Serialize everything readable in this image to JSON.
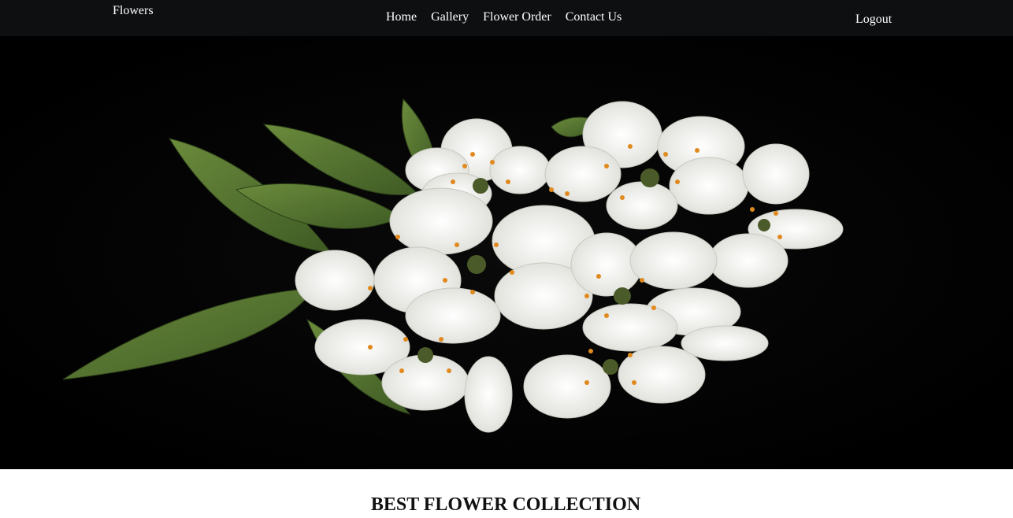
{
  "navbar": {
    "brand": "Flowers",
    "links": [
      "Home",
      "Gallery",
      "Flower Order",
      "Contact Us"
    ],
    "logout": "Logout"
  },
  "hero": {
    "icon": "white-blossom-image",
    "colors": {
      "background": "#020202",
      "petal": "#f4f4f2",
      "leaf": "#4f6f2f",
      "stamen": "#e08a1e"
    }
  },
  "section": {
    "title": "BEST FLOWER COLLECTION"
  }
}
